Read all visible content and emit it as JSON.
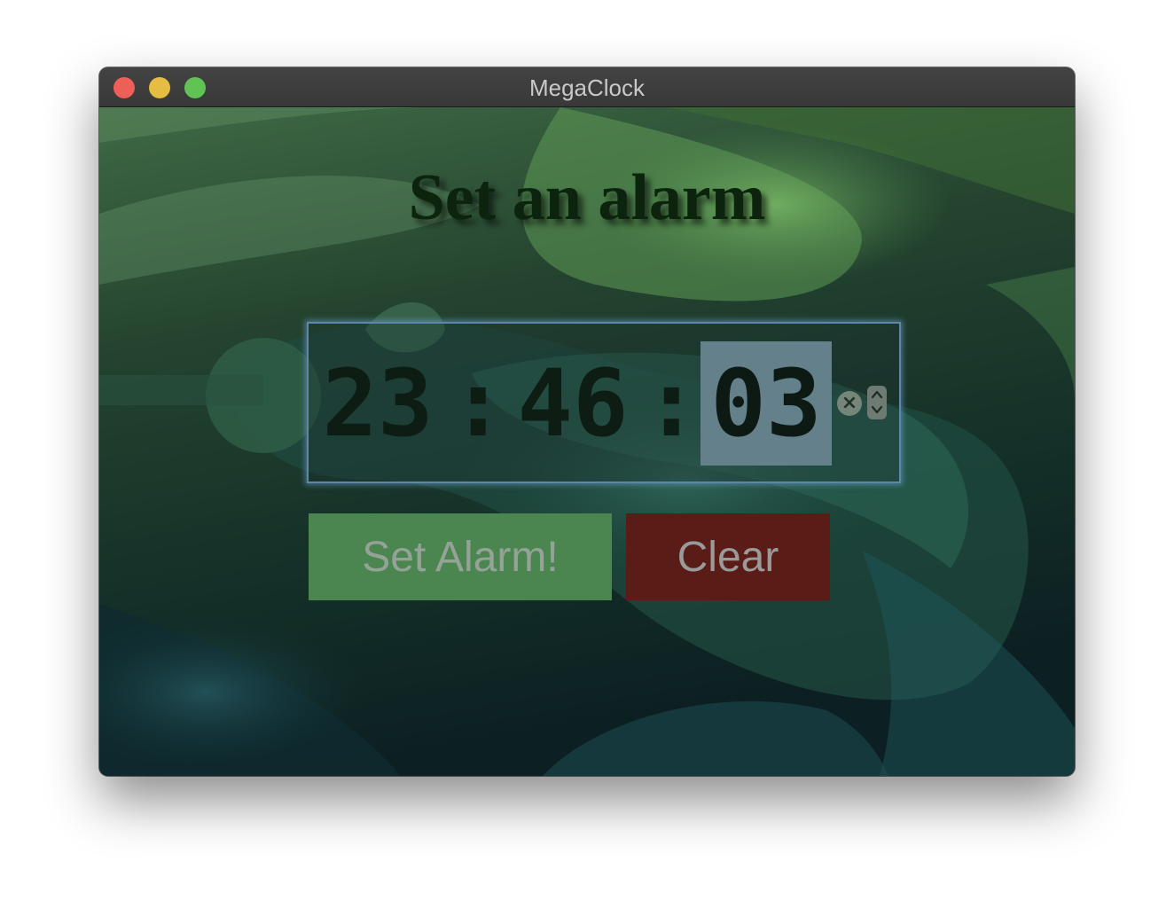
{
  "window": {
    "title": "MegaClock"
  },
  "page": {
    "heading": "Set an alarm"
  },
  "alarm_time": {
    "hours": "23",
    "minutes": "46",
    "seconds": "03",
    "separator": ":",
    "focused_segment": "seconds",
    "clear_icon": "×"
  },
  "buttons": {
    "set_label": "Set Alarm!",
    "clear_label": "Clear"
  },
  "colors": {
    "close": "#ed5f57",
    "minimize": "#e4bd42",
    "maximize": "#61c354",
    "set_button": "#4b8650",
    "clear_button": "#5a1c17",
    "focus_ring": "#5d86a8"
  }
}
